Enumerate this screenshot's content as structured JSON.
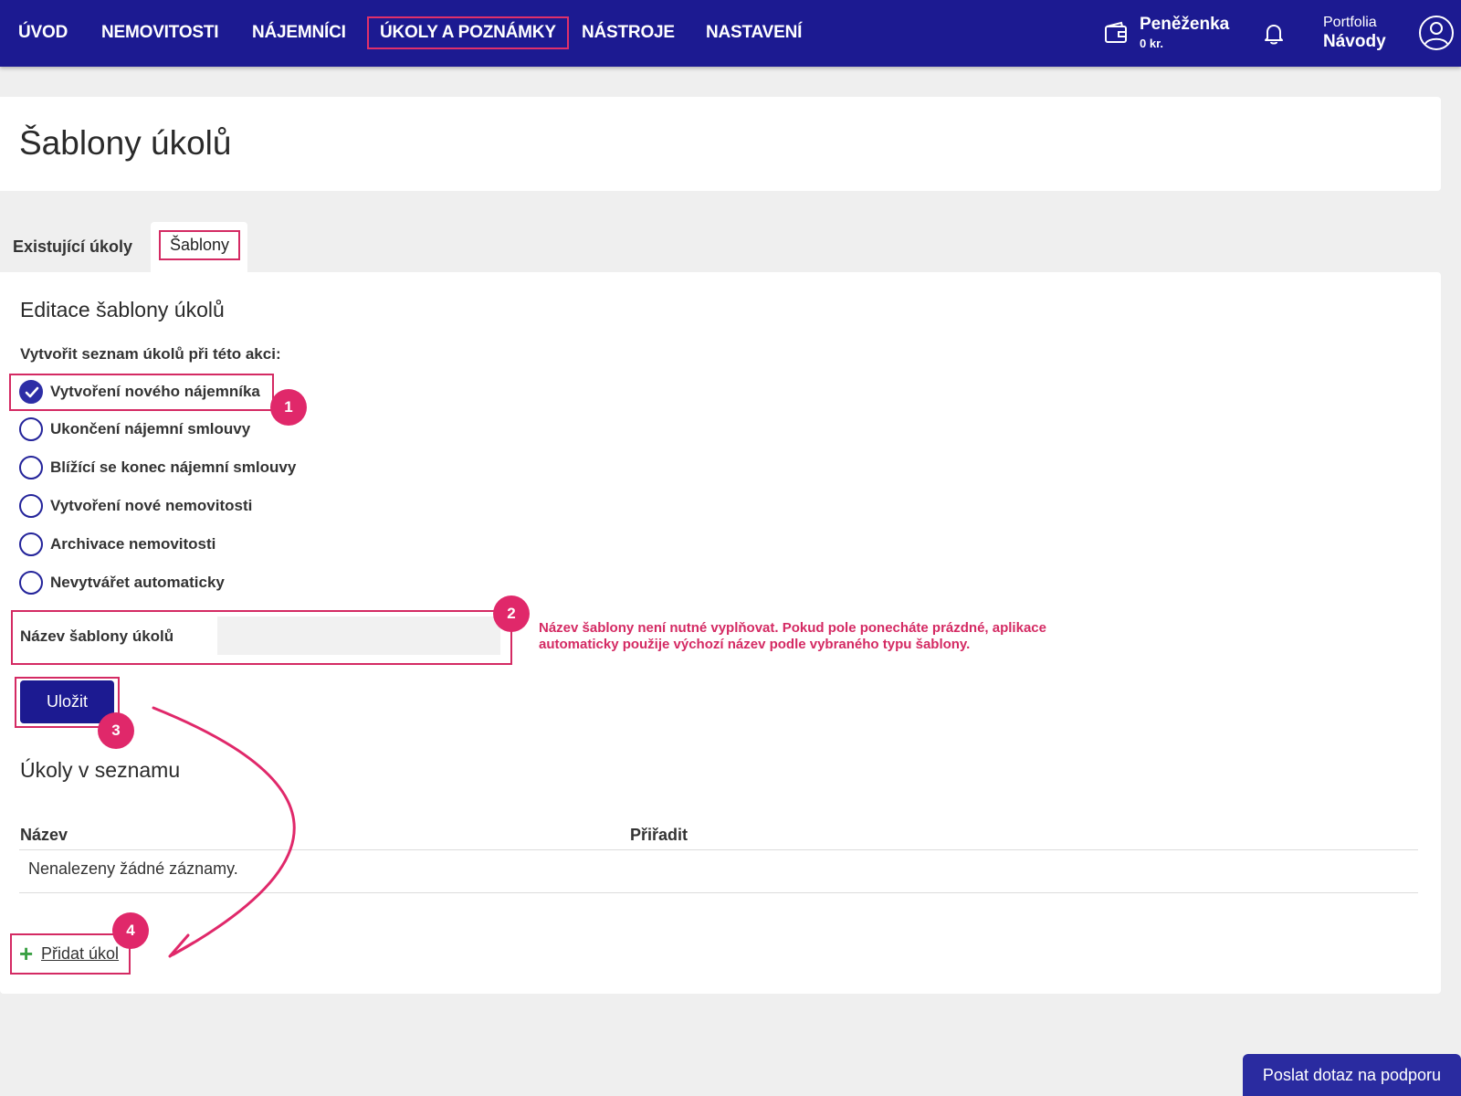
{
  "nav": {
    "items": [
      "ÚVOD",
      "NEMOVITOSTI",
      "NÁJEMNÍCI",
      "ÚKOLY A POZNÁMKY",
      "NÁSTROJE",
      "NASTAVENÍ"
    ],
    "active_index": 3,
    "wallet_title": "Peněženka",
    "wallet_amount": "0 kr.",
    "portfolio_label": "Portfolia",
    "portfolio_name": "Návody"
  },
  "page": {
    "title": "Šablony úkolů"
  },
  "tabs": [
    {
      "label": "Existující úkoly",
      "active": false
    },
    {
      "label": "Šablony",
      "active": true
    }
  ],
  "form": {
    "section_title": "Editace šablony úkolů",
    "trigger_label": "Vytvořit seznam úkolů při této akci:",
    "options": [
      {
        "label": "Vytvoření nového nájemníka",
        "checked": true
      },
      {
        "label": "Ukončení nájemní smlouvy",
        "checked": false
      },
      {
        "label": "Blížící se konec nájemní smlouvy",
        "checked": false
      },
      {
        "label": "Vytvoření nové nemovitosti",
        "checked": false
      },
      {
        "label": "Archivace nemovitosti",
        "checked": false
      },
      {
        "label": "Nevytvářet automaticky",
        "checked": false
      }
    ],
    "name_label": "Název šablony úkolů",
    "name_value": "",
    "hint": "Název šablony není nutné vyplňovat. Pokud pole ponecháte prázdné, aplikace automaticky použije výchozí název podle vybraného typu šablony.",
    "save_label": "Uložit"
  },
  "tasks": {
    "title": "Úkoly v seznamu",
    "columns": [
      "Název",
      "Přiřadit"
    ],
    "empty_text": "Nenalezeny žádné záznamy.",
    "add_label": "Přidat úkol"
  },
  "badges": [
    "1",
    "2",
    "3",
    "4"
  ],
  "support_label": "Poslat dotaz na podporu",
  "colors": {
    "nav_bg": "#1c1a91",
    "highlight": "#d42a63",
    "badge": "#e0286a",
    "plus": "#3aa043"
  },
  "icons": [
    "wallet-icon",
    "bell-icon",
    "user-avatar-icon",
    "check-icon",
    "plus-icon"
  ]
}
